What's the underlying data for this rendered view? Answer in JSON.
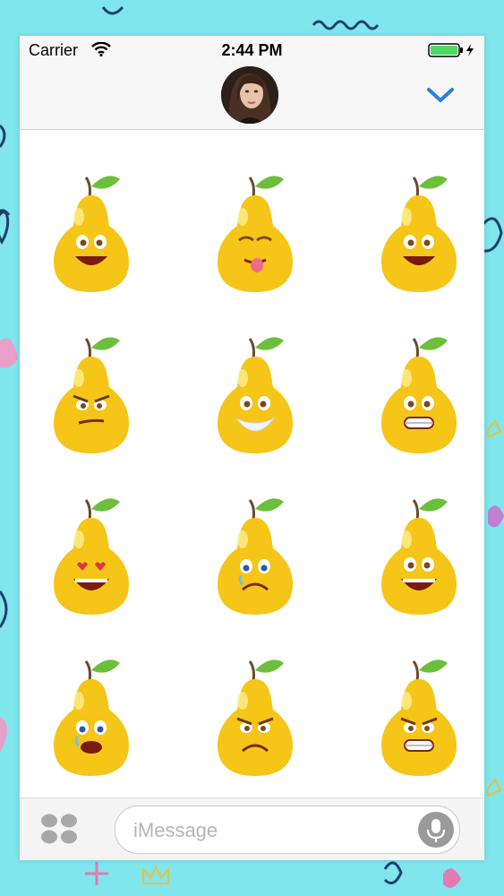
{
  "status_bar": {
    "carrier": "Carrier",
    "time": "2:44 PM",
    "wifi_icon": "wifi-icon",
    "battery_icon": "battery-icon",
    "battery_color": "#4cd964"
  },
  "header": {
    "avatar": "contact-avatar",
    "collapse_icon": "chevron-down-icon",
    "accent": "#2a7de1"
  },
  "stickers": [
    {
      "expression": "happy-smile"
    },
    {
      "expression": "tongue-wink"
    },
    {
      "expression": "grin"
    },
    {
      "expression": "angry-smirk"
    },
    {
      "expression": "old-man-beard"
    },
    {
      "expression": "gritted-teeth"
    },
    {
      "expression": "heart-eyes-laugh"
    },
    {
      "expression": "sad-tear"
    },
    {
      "expression": "big-smile"
    },
    {
      "expression": "crying"
    },
    {
      "expression": "frown"
    },
    {
      "expression": "angry-grimace"
    }
  ],
  "input_bar": {
    "placeholder": "iMessage",
    "apps_icon": "app-drawer-icon",
    "mic_icon": "microphone-icon"
  },
  "colors": {
    "background": "#7fe6ee",
    "pear_body": "#f5c518",
    "leaf": "#6cbf3a"
  }
}
